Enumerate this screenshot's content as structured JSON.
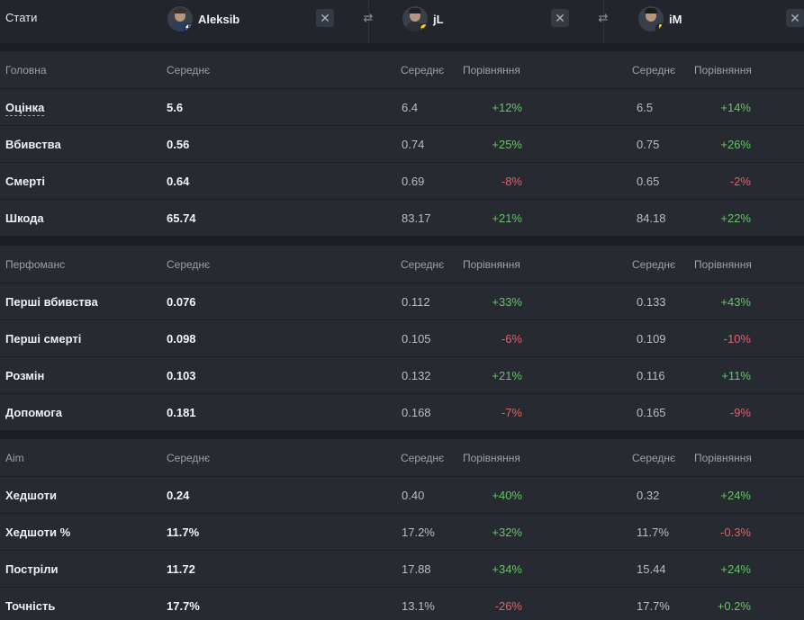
{
  "header": {
    "title": "Стати",
    "players": [
      {
        "name": "Aleksib",
        "flag_colors": [
          "#ffffff",
          "#2a5bd7"
        ]
      },
      {
        "name": "jL",
        "flag_colors": [
          "#f7c800",
          "#1a8a3a",
          "#c1272d"
        ]
      },
      {
        "name": "iM",
        "flag_colors": [
          "#002b7f",
          "#fcd116",
          "#ce1126"
        ]
      }
    ],
    "close_glyph": "✕",
    "swap_glyph": "⇄"
  },
  "columns": {
    "avg": "Середнє",
    "cmp": "Порівняння"
  },
  "sections": [
    {
      "title": "Головна",
      "rows": [
        {
          "label": "Оцінка",
          "v1": "5.6",
          "v2": "6.4",
          "c2": "+12%",
          "c2s": "pos",
          "v3": "6.5",
          "c3": "+14%",
          "c3s": "pos"
        },
        {
          "label": "Вбивства",
          "v1": "0.56",
          "v2": "0.74",
          "c2": "+25%",
          "c2s": "pos",
          "v3": "0.75",
          "c3": "+26%",
          "c3s": "pos"
        },
        {
          "label": "Смерті",
          "v1": "0.64",
          "v2": "0.69",
          "c2": "-8%",
          "c2s": "neg",
          "v3": "0.65",
          "c3": "-2%",
          "c3s": "neg"
        },
        {
          "label": "Шкода",
          "v1": "65.74",
          "v2": "83.17",
          "c2": "+21%",
          "c2s": "pos",
          "v3": "84.18",
          "c3": "+22%",
          "c3s": "pos"
        }
      ]
    },
    {
      "title": "Перфоманс",
      "rows": [
        {
          "label": "Перші вбивства",
          "v1": "0.076",
          "v2": "0.112",
          "c2": "+33%",
          "c2s": "pos",
          "v3": "0.133",
          "c3": "+43%",
          "c3s": "pos"
        },
        {
          "label": "Перші смерті",
          "v1": "0.098",
          "v2": "0.105",
          "c2": "-6%",
          "c2s": "neg",
          "v3": "0.109",
          "c3": "-10%",
          "c3s": "neg"
        },
        {
          "label": "Розмін",
          "v1": "0.103",
          "v2": "0.132",
          "c2": "+21%",
          "c2s": "pos",
          "v3": "0.116",
          "c3": "+11%",
          "c3s": "pos"
        },
        {
          "label": "Допомога",
          "v1": "0.181",
          "v2": "0.168",
          "c2": "-7%",
          "c2s": "neg",
          "v3": "0.165",
          "c3": "-9%",
          "c3s": "neg"
        }
      ]
    },
    {
      "title": "Aim",
      "rows": [
        {
          "label": "Хедшоти",
          "v1": "0.24",
          "v2": "0.40",
          "c2": "+40%",
          "c2s": "pos",
          "v3": "0.32",
          "c3": "+24%",
          "c3s": "pos"
        },
        {
          "label": "Хедшоти %",
          "v1": "11.7%",
          "v2": "17.2%",
          "c2": "+32%",
          "c2s": "pos",
          "v3": "11.7%",
          "c3": "-0.3%",
          "c3s": "neg"
        },
        {
          "label": "Постріли",
          "v1": "11.72",
          "v2": "17.88",
          "c2": "+34%",
          "c2s": "pos",
          "v3": "15.44",
          "c3": "+24%",
          "c3s": "pos"
        },
        {
          "label": "Точність",
          "v1": "17.7%",
          "v2": "13.1%",
          "c2": "-26%",
          "c2s": "neg",
          "v3": "17.7%",
          "c3": "+0.2%",
          "c3s": "pos"
        }
      ]
    }
  ]
}
